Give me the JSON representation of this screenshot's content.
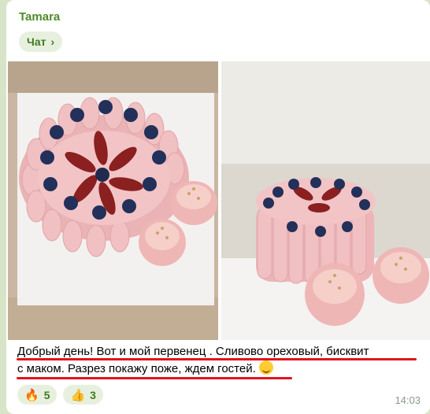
{
  "message": {
    "sender": "Tamara",
    "chat_button": {
      "label": "Чат",
      "icon": "chevron-right-icon"
    },
    "photos": [
      {
        "alt": "cake-top-view"
      },
      {
        "alt": "cake-side-view"
      }
    ],
    "text_line1": "Добрый день! Вот и мой первенец . Сливово ореховый, бисквит",
    "text_line2": "с маком. Разрез покажу поже, ждем гостей.",
    "reactions": [
      {
        "icon": "fire-icon",
        "glyph": "🔥",
        "count": "5"
      },
      {
        "icon": "thumbs-up-icon",
        "glyph": "👍",
        "count": "3"
      }
    ],
    "time": "14:03"
  },
  "colors": {
    "sender": "#4f8a2b",
    "accent_bg": "#e7f0de",
    "underline": "#e0141e"
  }
}
